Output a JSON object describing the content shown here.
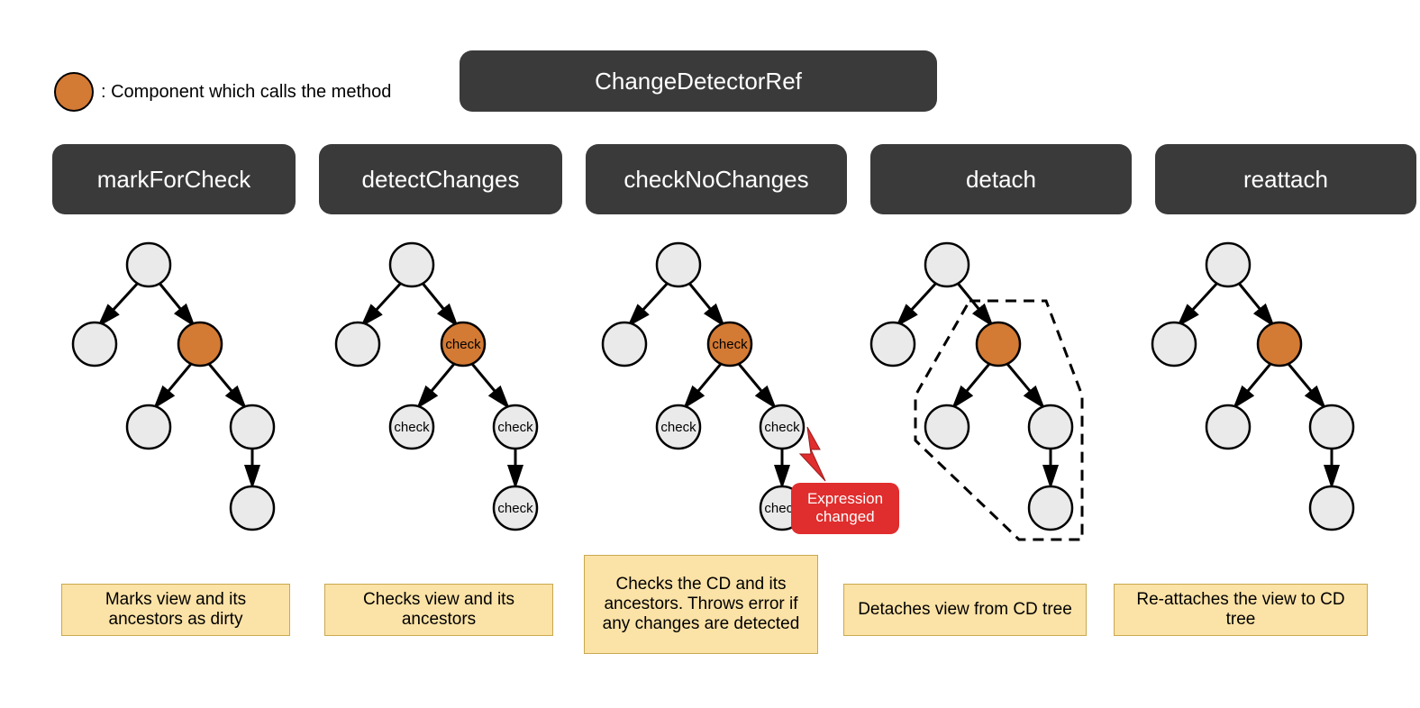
{
  "legend": {
    "label": ": Component which calls the method"
  },
  "title": "ChangeDetectorRef",
  "methods": [
    {
      "name": "markForCheck"
    },
    {
      "name": "detectChanges"
    },
    {
      "name": "checkNoChanges"
    },
    {
      "name": "detach"
    },
    {
      "name": "reattach"
    }
  ],
  "node_labels": {
    "check": "check"
  },
  "error": {
    "text": "Expression changed"
  },
  "descriptions": [
    "Marks view and its ancestors as dirty",
    "Checks view and its ancestors",
    "Checks the CD and its ancestors. Throws error if any changes are detected",
    "Detaches view from CD tree",
    "Re-attaches the view to CD tree"
  ],
  "colors": {
    "box_bg": "#3a3a3a",
    "box_fg": "#ffffff",
    "accent": "#d37a34",
    "node_fill": "#eaeaea",
    "desc_bg": "#fbe2a6",
    "desc_border": "#c9a84f",
    "error_bg": "#e02d2d"
  },
  "trees": [
    {
      "method": "markForCheck",
      "caller_index": 2,
      "check_labels": [],
      "dashed_subtree": false
    },
    {
      "method": "detectChanges",
      "caller_index": 2,
      "check_labels": [
        2,
        3,
        4,
        5
      ],
      "dashed_subtree": false
    },
    {
      "method": "checkNoChanges",
      "caller_index": 2,
      "check_labels": [
        2,
        3,
        4,
        5
      ],
      "dashed_subtree": false,
      "error_on_node": 5
    },
    {
      "method": "detach",
      "caller_index": 2,
      "check_labels": [],
      "dashed_subtree": true
    },
    {
      "method": "reattach",
      "caller_index": 2,
      "check_labels": [],
      "dashed_subtree": false
    }
  ]
}
